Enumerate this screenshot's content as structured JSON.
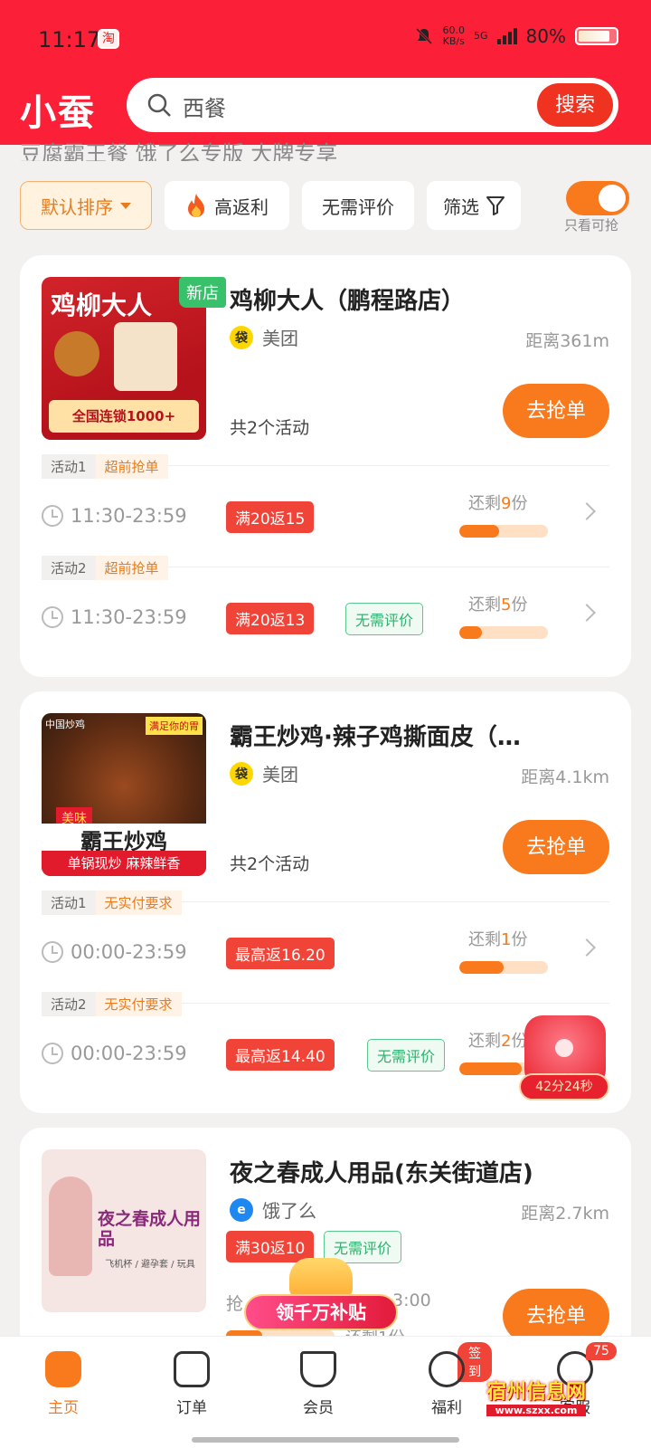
{
  "status_bar": {
    "time": "11:17",
    "notify_icon": "taobao-icon",
    "speed_value": "60.0",
    "speed_unit": "KB/s",
    "network": "5G",
    "battery": "80%"
  },
  "header": {
    "logo": "小蚕",
    "search_placeholder": "西餐",
    "search_button": "搜索"
  },
  "scrolled_tabs": "豆腐霸王餐    饿了么专版    大牌专享",
  "filters": {
    "default_sort": "默认排序",
    "high_rebate": "高返利",
    "no_review": "无需评价",
    "filter": "筛选",
    "only_available": "只看可抢",
    "only_available_on": true
  },
  "cards": [
    {
      "thumb_title": "鸡柳大人",
      "thumb_sub": "全国连锁1000+",
      "new_tag": "新店",
      "name": "鸡柳大人（鹏程路店）",
      "platform": "美团",
      "distance": "距离361m",
      "activity_count": "共2个活动",
      "grab_label": "去抢单",
      "activities": [
        {
          "label": "活动1",
          "type": "超前抢单",
          "time": "11:30-23:59",
          "rebate": "满20返15",
          "review": "",
          "remain_prefix": "还剩",
          "remain_num": "9",
          "remain_suffix": "份",
          "progress": 0.45
        },
        {
          "label": "活动2",
          "type": "超前抢单",
          "time": "11:30-23:59",
          "rebate": "满20返13",
          "review": "无需评价",
          "remain_prefix": "还剩",
          "remain_num": "5",
          "remain_suffix": "份",
          "progress": 0.25
        }
      ]
    },
    {
      "thumb_title": "霸王炒鸡",
      "thumb_sub": "单锅现炒 麻辣鲜香",
      "thumb_corner": "中国炒鸡",
      "thumb_slogan": "满足你的胃",
      "thumb_badge": "美味",
      "new_tag": "",
      "name": "霸王炒鸡·辣子鸡撕面皮（…",
      "platform": "美团",
      "distance": "距离4.1km",
      "activity_count": "共2个活动",
      "grab_label": "去抢单",
      "activities": [
        {
          "label": "活动1",
          "type": "无实付要求",
          "time": "00:00-23:59",
          "rebate": "最高返16.20",
          "review": "",
          "remain_prefix": "还剩",
          "remain_num": "1",
          "remain_suffix": "份",
          "progress": 0.5
        },
        {
          "label": "活动2",
          "type": "无实付要求",
          "time": "00:00-23:59",
          "rebate": "最高返14.40",
          "review": "无需评价",
          "remain_prefix": "还剩",
          "remain_num": "2",
          "remain_suffix": "份",
          "progress": 0.7
        }
      ]
    },
    {
      "thumb_title": "夜之春成人用品",
      "thumb_sub": "飞机杯 / 避孕套 / 玩具",
      "new_tag": "",
      "name": "夜之春成人用品(东关街道店)",
      "platform": "饿了么",
      "distance": "距离2.7km",
      "rebate": "满30返10",
      "review": "无需评价",
      "time_partial": "抢",
      "time_end": "3:00",
      "remain_partial": "还剩1份",
      "grab_label": "去抢单"
    }
  ],
  "floating": {
    "countdown": "42分24秒",
    "subsidy": "领千万补贴"
  },
  "bottom_nav": [
    {
      "label": "主页",
      "icon": "home-icon",
      "active": true
    },
    {
      "label": "订单",
      "icon": "order-icon"
    },
    {
      "label": "会员",
      "icon": "member-icon"
    },
    {
      "label": "福利",
      "icon": "welfare-icon",
      "badge": "签到"
    },
    {
      "label": "客服",
      "icon": "service-icon",
      "badge": "75"
    }
  ],
  "watermark": {
    "title": "宿州信息网",
    "url": "www.szxx.com"
  },
  "colors": {
    "brand_red": "#fb2037",
    "accent_orange": "#f9791d",
    "tag_red": "#f04438",
    "tag_green": "#2db36d"
  }
}
